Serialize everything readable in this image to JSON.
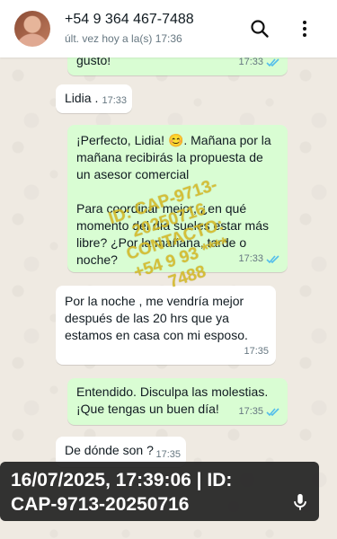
{
  "contact": {
    "name": "+54 9 364 467-7488",
    "status": "últ. vez hoy a la(s) 17:36"
  },
  "icons": {
    "avatar": "contact-photo",
    "search": "search-icon",
    "menu": "more-vert-icon",
    "read": "double-check-icon",
    "mic": "mic-icon"
  },
  "colors": {
    "outgoing_bubble": "#d9fdd3",
    "incoming_bubble": "#ffffff",
    "read_ticks": "#53bdeb",
    "watermark": "#dabe28",
    "overlay": "#232323"
  },
  "messages": [
    {
      "direction": "out",
      "text": "gusto!",
      "time": "17:33",
      "read": true
    },
    {
      "direction": "in",
      "text": "Lidia .",
      "time": "17:33"
    },
    {
      "direction": "out",
      "text": "¡Perfecto, Lidia! 😊. Mañana por la mañana recibirás la propuesta de un asesor comercial",
      "time": ""
    },
    {
      "direction": "out",
      "text": "Para coordinar mejor, ¿en qué momento del día sueles estar más libre? ¿Por la mañana, tarde o noche?",
      "time": "17:33",
      "read": true
    },
    {
      "direction": "in",
      "text": "Por la noche , me vendría mejor después de las 20 hrs que ya estamos en casa con mi esposo.",
      "time": "17:35"
    },
    {
      "direction": "out",
      "text": "Entendido. Disculpa las molestias. ¡Que tengas un buen día!",
      "time": "17:35",
      "read": true
    },
    {
      "direction": "in",
      "text": "De dónde son ?",
      "time": "17:35"
    }
  ],
  "watermark": {
    "line1": "ID: CAP-9713-",
    "line2": "20250716",
    "line3": "CONTACTO:",
    "line4": "+54 9 93 ****",
    "line5": "7488"
  },
  "overlay": {
    "line1": "16/07/2025, 17:39:06 | ID:",
    "line2": "CAP-9713-20250716"
  }
}
